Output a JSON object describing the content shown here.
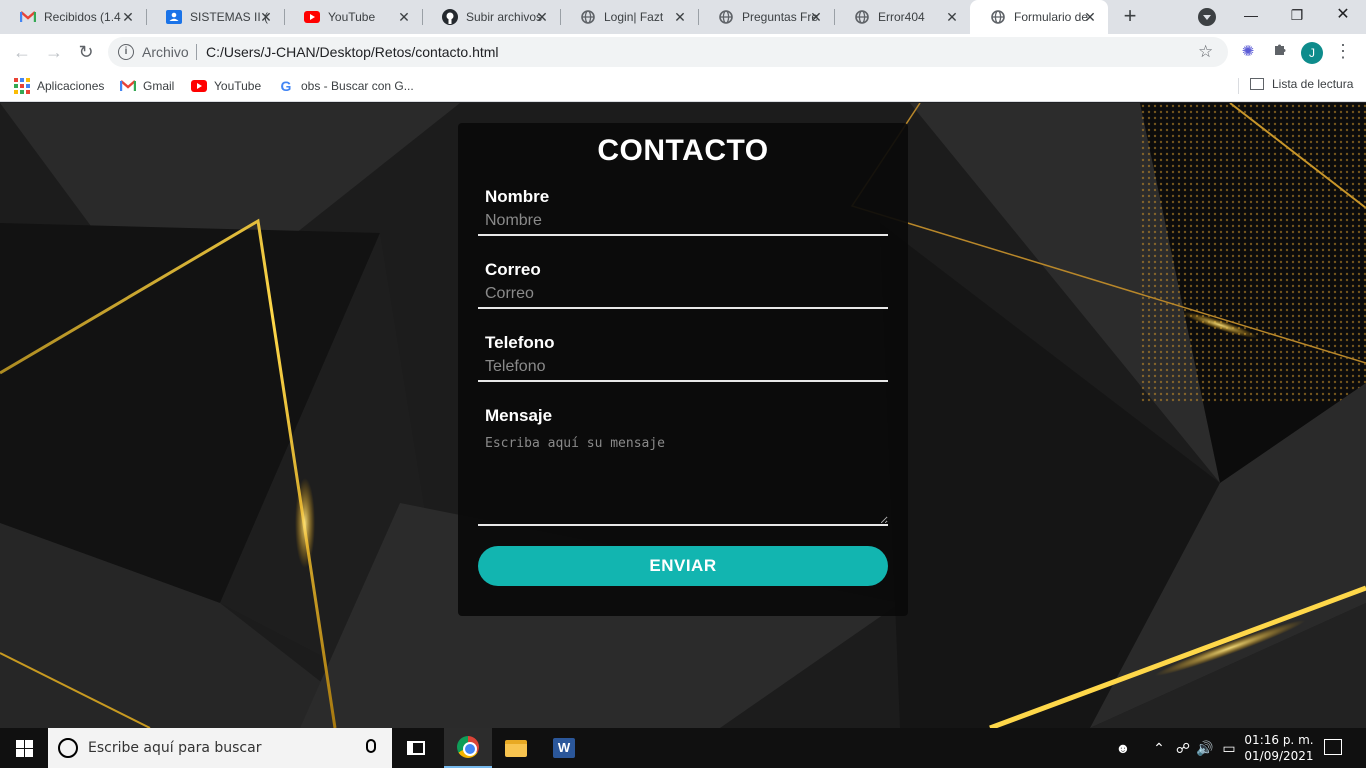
{
  "browser": {
    "tabs": [
      {
        "title": "Recibidos (1.4",
        "icon": "gmail-icon"
      },
      {
        "title": "SISTEMAS II (",
        "icon": "classroom-icon"
      },
      {
        "title": "YouTube",
        "icon": "youtube-icon"
      },
      {
        "title": "Subir archivos",
        "icon": "github-icon"
      },
      {
        "title": "Login| Fazt",
        "icon": "globe-icon"
      },
      {
        "title": "Preguntas Fre",
        "icon": "globe-icon"
      },
      {
        "title": "Error404",
        "icon": "globe-icon"
      },
      {
        "title": "Formulario de",
        "icon": "globe-icon",
        "active": true
      }
    ],
    "address": {
      "scheme_label": "Archivo",
      "url": "C:/Users/J-CHAN/Desktop/Retos/contacto.html"
    },
    "profile_initial": "J",
    "bookmarks": [
      {
        "label": "Aplicaciones",
        "icon": "apps-grid-icon"
      },
      {
        "label": "Gmail",
        "icon": "gmail-icon"
      },
      {
        "label": "YouTube",
        "icon": "youtube-icon"
      },
      {
        "label": "obs - Buscar con G...",
        "icon": "google-icon"
      }
    ],
    "reading_list": "Lista de lectura"
  },
  "form": {
    "title": "CONTACTO",
    "fields": [
      {
        "label": "Nombre",
        "placeholder": "Nombre",
        "value": ""
      },
      {
        "label": "Correo",
        "placeholder": "Correo",
        "value": ""
      },
      {
        "label": "Telefono",
        "placeholder": "Telefono",
        "value": ""
      }
    ],
    "message": {
      "label": "Mensaje",
      "placeholder": "Escriba aquí su mensaje",
      "value": ""
    },
    "submit_label": "ENVIAR",
    "accent_color": "#12b5b0"
  },
  "taskbar": {
    "search_placeholder": "Escribe aquí para buscar",
    "time": "01:16 p. m.",
    "date": "01/09/2021",
    "apps": [
      "task-view-icon",
      "chrome-icon",
      "file-explorer-icon",
      "word-icon"
    ]
  }
}
